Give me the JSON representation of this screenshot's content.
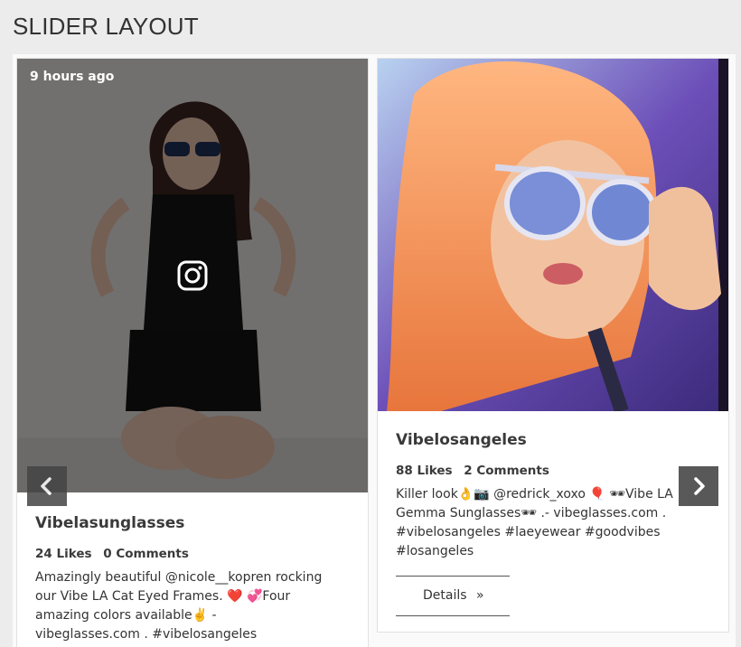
{
  "page_title": "SLIDER LAYOUT",
  "cards": [
    {
      "time": "9 hours ago",
      "username": "Vibelasunglasses",
      "likes": "24 Likes",
      "comments": "0 Comments",
      "caption": "Amazingly beautiful @nicole__kopren  rocking our Vibe LA Cat Eyed Frames. ❤️ 💞Four amazing colors available✌️ - vibeglasses.com . #vibelosangeles #vibesunglasses"
    },
    {
      "username": "Vibelosangeles",
      "likes": "88 Likes",
      "comments": "2 Comments",
      "caption": "Killer look👌📷 @redrick_xoxo 🎈 🕶Vibe LA Gemma Sunglasses🕶 .- vibeglasses.com . #vibelosangeles #laeyewear #goodvibes #losangeles",
      "details_label": "Details",
      "details_icon": "»"
    }
  ],
  "nav": {
    "prev_icon": "chevron-left-icon",
    "next_icon": "chevron-right-icon"
  }
}
